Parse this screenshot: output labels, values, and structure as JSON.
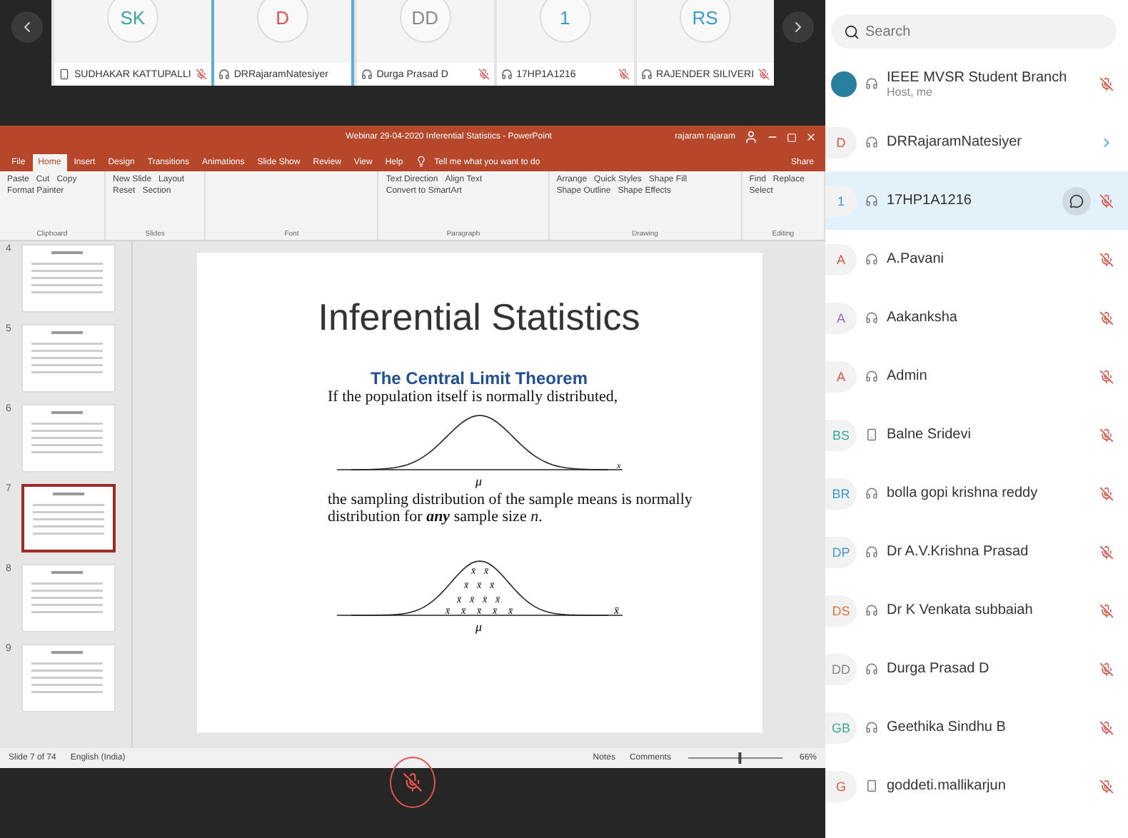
{
  "video_strip": {
    "tiles": [
      {
        "initials": "SK",
        "color": "#3aa89a",
        "name": "SUDHAKAR KATTUPALLI",
        "kind": "phone",
        "muted": true,
        "active": false
      },
      {
        "initials": "D",
        "color": "#e0524a",
        "name": "DRRajaramNatesiyer",
        "kind": "headset",
        "muted": false,
        "active": true
      },
      {
        "initials": "DD",
        "color": "#8a8a8a",
        "name": "Durga Prasad D",
        "kind": "headset",
        "muted": true,
        "active": false
      },
      {
        "initials": "1",
        "color": "#3a9ad9",
        "name": "17HP1A1216",
        "kind": "headset",
        "muted": true,
        "active": false
      },
      {
        "initials": "RS",
        "color": "#3a9ad9",
        "name": "RAJENDER SILIVERI",
        "kind": "headset",
        "muted": true,
        "active": false
      }
    ]
  },
  "presentation": {
    "window_title": "Webinar 29-04-2020 Inferential Statistics  -  PowerPoint",
    "user": "rajaram rajaram",
    "tabs": [
      {
        "label": "File",
        "selected": false
      },
      {
        "label": "Home",
        "selected": true
      },
      {
        "label": "Insert",
        "selected": false
      },
      {
        "label": "Design",
        "selected": false
      },
      {
        "label": "Transitions",
        "selected": false
      },
      {
        "label": "Animations",
        "selected": false
      },
      {
        "label": "Slide Show",
        "selected": false
      },
      {
        "label": "Review",
        "selected": false
      },
      {
        "label": "View",
        "selected": false
      },
      {
        "label": "Help",
        "selected": false
      }
    ],
    "tell_me": "Tell me what you want to do",
    "share": "Share",
    "ribbon_groups": [
      {
        "name": "Clipboard",
        "items": [
          "Paste",
          "Cut",
          "Copy",
          "Format Painter"
        ]
      },
      {
        "name": "Slides",
        "items": [
          "New Slide",
          "Layout",
          "Reset",
          "Section"
        ]
      },
      {
        "name": "Font"
      },
      {
        "name": "Paragraph",
        "items": [
          "Text Direction",
          "Align Text",
          "Convert to SmartArt"
        ]
      },
      {
        "name": "Drawing",
        "items": [
          "Arrange",
          "Quick Styles",
          "Shape Fill",
          "Shape Outline",
          "Shape Effects"
        ]
      },
      {
        "name": "Editing",
        "items": [
          "Find",
          "Replace",
          "Select"
        ]
      }
    ],
    "thumbnails": [
      {
        "number": "4",
        "selected": false
      },
      {
        "number": "5",
        "selected": false
      },
      {
        "number": "6",
        "selected": false
      },
      {
        "number": "7",
        "selected": true
      },
      {
        "number": "8",
        "selected": false
      },
      {
        "number": "9",
        "selected": false
      }
    ],
    "slide": {
      "title": "Inferential Statistics",
      "subtitle": "The Central Limit Theorem",
      "line_1": "If the population itself is normally distributed,",
      "mean_label_1": "μ",
      "axis_label_1": "x",
      "line_2": "the sampling distribution of the sample means is normally distribution for **any** sample size *n*.",
      "sample_means": [
        "x̄",
        "x̄",
        "x̄",
        "x̄",
        "x̄",
        "x̄",
        "x̄",
        "x̄",
        "x̄",
        "x̄",
        "x̄",
        "x̄",
        "x̄",
        "x̄"
      ],
      "mean_label_2": "μ",
      "axis_label_2": "x̄"
    },
    "status_bar": {
      "slide_count": "Slide 7 of 74",
      "language": "English (India)",
      "notes": "Notes",
      "comments": "Comments",
      "zoom_slider": {
        "level": 0.55
      },
      "zoom": "66%"
    }
  },
  "audio": {
    "muted": true
  },
  "participants": {
    "search_placeholder": "Search",
    "items": [
      {
        "logo": true,
        "color": "#2a7f9e",
        "kind": "headset",
        "name": "IEEE MVSR Student Branch",
        "subtitle": "Host, me",
        "muted": true,
        "expandable": false,
        "selected": false
      },
      {
        "initials": "D",
        "color": "#e0524a",
        "kind": "headset",
        "name": "DRRajaramNatesiyer",
        "muted": false,
        "expandable": true,
        "selected": false
      },
      {
        "initials": "1",
        "color": "#3a9ad9",
        "kind": "headset",
        "name": "17HP1A1216",
        "muted": true,
        "expandable": false,
        "selected": true
      },
      {
        "initials": "A",
        "color": "#e0524a",
        "kind": "headset",
        "name": "A.Pavani",
        "muted": true,
        "expandable": false,
        "selected": false
      },
      {
        "initials": "A",
        "color": "#9b6fc9",
        "kind": "headset",
        "name": "Aakanksha",
        "muted": true,
        "expandable": false,
        "selected": false
      },
      {
        "initials": "A",
        "color": "#e0524a",
        "kind": "headset",
        "name": "Admin",
        "muted": true,
        "expandable": false,
        "selected": false
      },
      {
        "initials": "BS",
        "color": "#3aa89a",
        "kind": "phone",
        "name": "Balne Sridevi",
        "muted": true,
        "expandable": false,
        "selected": false
      },
      {
        "initials": "BR",
        "color": "#3a9ad9",
        "kind": "headset",
        "name": "bolla gopi krishna reddy",
        "muted": true,
        "expandable": false,
        "selected": false
      },
      {
        "initials": "DP",
        "color": "#3a9ad9",
        "kind": "headset",
        "name": "Dr A.V.Krishna Prasad",
        "muted": true,
        "expandable": false,
        "selected": false
      },
      {
        "initials": "DS",
        "color": "#e8733a",
        "kind": "headset",
        "name": "Dr K Venkata subbaiah",
        "muted": true,
        "expandable": false,
        "selected": false
      },
      {
        "initials": "DD",
        "color": "#8a8a8a",
        "kind": "headset",
        "name": "Durga Prasad D",
        "muted": true,
        "expandable": false,
        "selected": false
      },
      {
        "initials": "GB",
        "color": "#3aa89a",
        "kind": "headset",
        "name": "Geethika Sindhu B",
        "muted": true,
        "expandable": false,
        "selected": false
      },
      {
        "initials": "G",
        "color": "#e0524a",
        "kind": "phone",
        "name": "goddeti.mallikarjun",
        "muted": true,
        "expandable": false,
        "selected": false
      }
    ]
  }
}
